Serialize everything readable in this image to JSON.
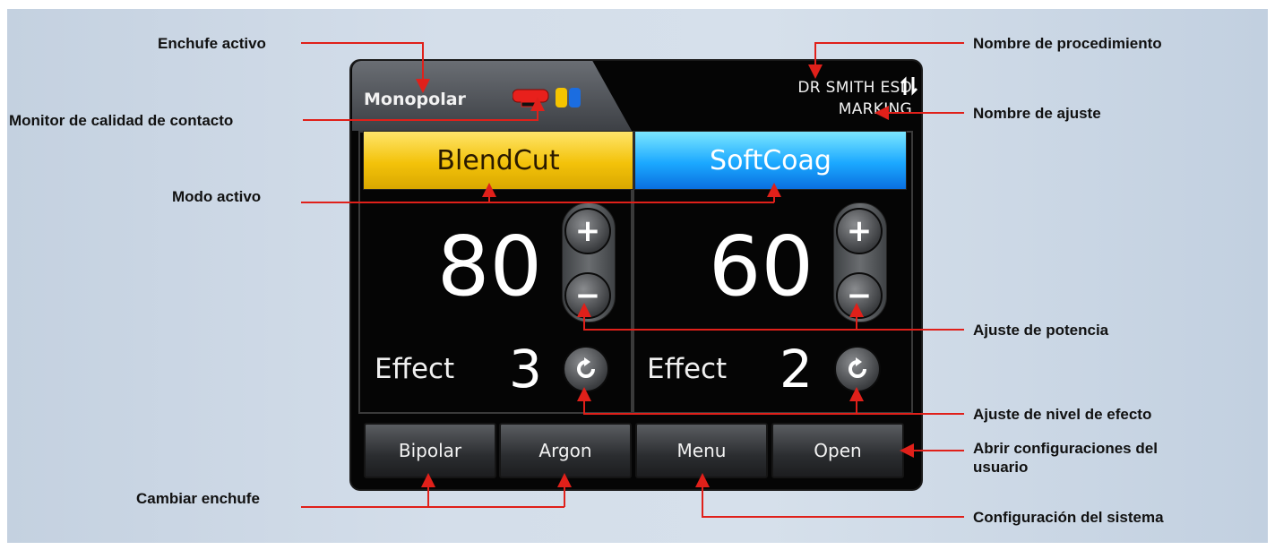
{
  "device": {
    "active_plug": "Monopolar",
    "procedure_name": "DR SMITH ESD",
    "setting_name": "MARKING",
    "sort_icon": "sort-arrows-icon",
    "left": {
      "mode": "BlendCut",
      "power": "80",
      "effect_label": "Effect",
      "effect": "3"
    },
    "right": {
      "mode": "SoftCoag",
      "power": "60",
      "effect_label": "Effect",
      "effect": "2"
    },
    "buttons": {
      "bipolar": "Bipolar",
      "argon": "Argon",
      "menu": "Menu",
      "open": "Open"
    },
    "colors": {
      "left_mode": "#f3c20a",
      "right_mode": "#1ba8ff",
      "plug_red": "#e8201c",
      "plug_yellow": "#f5c400",
      "plug_blue": "#1b6de0"
    }
  },
  "callouts": {
    "active_plug": "Enchufe activo",
    "contact_monitor": "Monitor de calidad de contacto",
    "active_mode": "Modo activo",
    "change_plug": "Cambiar enchufe",
    "procedure_name": "Nombre de procedimiento",
    "setting_name": "Nombre de ajuste",
    "power_adjust": "Ajuste de potencia",
    "effect_adjust": "Ajuste de nivel de efecto",
    "user_settings": "Abrir configuraciones del usuario",
    "system_config": "Configuración del sistema"
  },
  "line_color": "#e0201a"
}
